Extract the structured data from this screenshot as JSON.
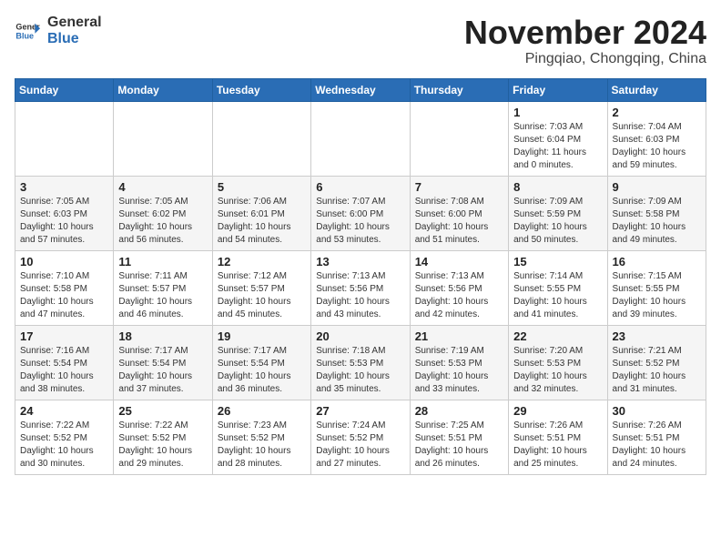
{
  "header": {
    "logo_general": "General",
    "logo_blue": "Blue",
    "month_title": "November 2024",
    "location": "Pingqiao, Chongqing, China"
  },
  "weekdays": [
    "Sunday",
    "Monday",
    "Tuesday",
    "Wednesday",
    "Thursday",
    "Friday",
    "Saturday"
  ],
  "weeks": [
    [
      {
        "day": "",
        "info": ""
      },
      {
        "day": "",
        "info": ""
      },
      {
        "day": "",
        "info": ""
      },
      {
        "day": "",
        "info": ""
      },
      {
        "day": "",
        "info": ""
      },
      {
        "day": "1",
        "info": "Sunrise: 7:03 AM\nSunset: 6:04 PM\nDaylight: 11 hours and 0 minutes."
      },
      {
        "day": "2",
        "info": "Sunrise: 7:04 AM\nSunset: 6:03 PM\nDaylight: 10 hours and 59 minutes."
      }
    ],
    [
      {
        "day": "3",
        "info": "Sunrise: 7:05 AM\nSunset: 6:03 PM\nDaylight: 10 hours and 57 minutes."
      },
      {
        "day": "4",
        "info": "Sunrise: 7:05 AM\nSunset: 6:02 PM\nDaylight: 10 hours and 56 minutes."
      },
      {
        "day": "5",
        "info": "Sunrise: 7:06 AM\nSunset: 6:01 PM\nDaylight: 10 hours and 54 minutes."
      },
      {
        "day": "6",
        "info": "Sunrise: 7:07 AM\nSunset: 6:00 PM\nDaylight: 10 hours and 53 minutes."
      },
      {
        "day": "7",
        "info": "Sunrise: 7:08 AM\nSunset: 6:00 PM\nDaylight: 10 hours and 51 minutes."
      },
      {
        "day": "8",
        "info": "Sunrise: 7:09 AM\nSunset: 5:59 PM\nDaylight: 10 hours and 50 minutes."
      },
      {
        "day": "9",
        "info": "Sunrise: 7:09 AM\nSunset: 5:58 PM\nDaylight: 10 hours and 49 minutes."
      }
    ],
    [
      {
        "day": "10",
        "info": "Sunrise: 7:10 AM\nSunset: 5:58 PM\nDaylight: 10 hours and 47 minutes."
      },
      {
        "day": "11",
        "info": "Sunrise: 7:11 AM\nSunset: 5:57 PM\nDaylight: 10 hours and 46 minutes."
      },
      {
        "day": "12",
        "info": "Sunrise: 7:12 AM\nSunset: 5:57 PM\nDaylight: 10 hours and 45 minutes."
      },
      {
        "day": "13",
        "info": "Sunrise: 7:13 AM\nSunset: 5:56 PM\nDaylight: 10 hours and 43 minutes."
      },
      {
        "day": "14",
        "info": "Sunrise: 7:13 AM\nSunset: 5:56 PM\nDaylight: 10 hours and 42 minutes."
      },
      {
        "day": "15",
        "info": "Sunrise: 7:14 AM\nSunset: 5:55 PM\nDaylight: 10 hours and 41 minutes."
      },
      {
        "day": "16",
        "info": "Sunrise: 7:15 AM\nSunset: 5:55 PM\nDaylight: 10 hours and 39 minutes."
      }
    ],
    [
      {
        "day": "17",
        "info": "Sunrise: 7:16 AM\nSunset: 5:54 PM\nDaylight: 10 hours and 38 minutes."
      },
      {
        "day": "18",
        "info": "Sunrise: 7:17 AM\nSunset: 5:54 PM\nDaylight: 10 hours and 37 minutes."
      },
      {
        "day": "19",
        "info": "Sunrise: 7:17 AM\nSunset: 5:54 PM\nDaylight: 10 hours and 36 minutes."
      },
      {
        "day": "20",
        "info": "Sunrise: 7:18 AM\nSunset: 5:53 PM\nDaylight: 10 hours and 35 minutes."
      },
      {
        "day": "21",
        "info": "Sunrise: 7:19 AM\nSunset: 5:53 PM\nDaylight: 10 hours and 33 minutes."
      },
      {
        "day": "22",
        "info": "Sunrise: 7:20 AM\nSunset: 5:53 PM\nDaylight: 10 hours and 32 minutes."
      },
      {
        "day": "23",
        "info": "Sunrise: 7:21 AM\nSunset: 5:52 PM\nDaylight: 10 hours and 31 minutes."
      }
    ],
    [
      {
        "day": "24",
        "info": "Sunrise: 7:22 AM\nSunset: 5:52 PM\nDaylight: 10 hours and 30 minutes."
      },
      {
        "day": "25",
        "info": "Sunrise: 7:22 AM\nSunset: 5:52 PM\nDaylight: 10 hours and 29 minutes."
      },
      {
        "day": "26",
        "info": "Sunrise: 7:23 AM\nSunset: 5:52 PM\nDaylight: 10 hours and 28 minutes."
      },
      {
        "day": "27",
        "info": "Sunrise: 7:24 AM\nSunset: 5:52 PM\nDaylight: 10 hours and 27 minutes."
      },
      {
        "day": "28",
        "info": "Sunrise: 7:25 AM\nSunset: 5:51 PM\nDaylight: 10 hours and 26 minutes."
      },
      {
        "day": "29",
        "info": "Sunrise: 7:26 AM\nSunset: 5:51 PM\nDaylight: 10 hours and 25 minutes."
      },
      {
        "day": "30",
        "info": "Sunrise: 7:26 AM\nSunset: 5:51 PM\nDaylight: 10 hours and 24 minutes."
      }
    ]
  ]
}
